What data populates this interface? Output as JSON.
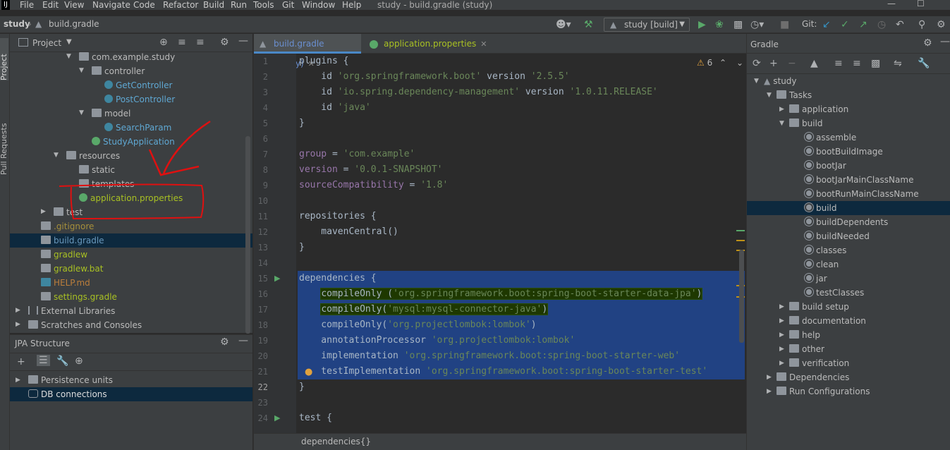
{
  "menubar": {
    "logo": "IJ",
    "items": [
      "File",
      "Edit",
      "View",
      "Navigate",
      "Code",
      "Refactor",
      "Build",
      "Run",
      "Tools",
      "Git",
      "Window",
      "Help"
    ],
    "window_title": "study - build.gradle (study)"
  },
  "navbar": {
    "project": "study",
    "file": "build.gradle",
    "run_config": "study [build]",
    "git_label": "Git:"
  },
  "left_stripe": {
    "project_tab": "Project",
    "pr_tab": "Pull Requests"
  },
  "project_panel": {
    "header": "Project",
    "tree": [
      {
        "label": "com.example.study",
        "kind": "package"
      },
      {
        "label": "controller",
        "kind": "package"
      },
      {
        "label": "GetController",
        "kind": "class"
      },
      {
        "label": "PostController",
        "kind": "class"
      },
      {
        "label": "model",
        "kind": "package"
      },
      {
        "label": "SearchParam",
        "kind": "class"
      },
      {
        "label": "StudyApplication",
        "kind": "class"
      },
      {
        "label": "resources",
        "kind": "folder"
      },
      {
        "label": "static",
        "kind": "folder"
      },
      {
        "label": "templates",
        "kind": "folder"
      },
      {
        "label": "application.properties",
        "kind": "file"
      },
      {
        "label": "test",
        "kind": "folder"
      },
      {
        "label": ".gitignore",
        "kind": "file"
      },
      {
        "label": "build.gradle",
        "kind": "file"
      },
      {
        "label": "gradlew",
        "kind": "file"
      },
      {
        "label": "gradlew.bat",
        "kind": "file"
      },
      {
        "label": "HELP.md",
        "kind": "file"
      },
      {
        "label": "settings.gradle",
        "kind": "file"
      },
      {
        "label": "External Libraries",
        "kind": "lib"
      },
      {
        "label": "Scratches and Consoles",
        "kind": "scratch"
      }
    ]
  },
  "jpa_panel": {
    "header": "JPA Structure",
    "items": [
      "Persistence units",
      "DB connections"
    ]
  },
  "editor": {
    "tabs": [
      {
        "label": "build.gradle (study)",
        "active": true
      },
      {
        "label": "application.properties",
        "active": false
      }
    ],
    "warnings": "6",
    "line_numbers": [
      "1",
      "2",
      "3",
      "4",
      "5",
      "6",
      "7",
      "8",
      "9",
      "10",
      "11",
      "12",
      "13",
      "14",
      "15",
      "16",
      "17",
      "18",
      "19",
      "20",
      "21",
      "22",
      "23",
      "24"
    ],
    "breadcrumb": "dependencies{}"
  },
  "gradle_panel": {
    "header": "Gradle",
    "tree": {
      "root": "study",
      "tasks": "Tasks",
      "application": "application",
      "build_group": "build",
      "build_tasks": [
        "assemble",
        "bootBuildImage",
        "bootJar",
        "bootJarMainClassName",
        "bootRunMainClassName",
        "build",
        "buildDependents",
        "buildNeeded",
        "classes",
        "clean",
        "jar",
        "testClasses"
      ],
      "other_groups": [
        "build setup",
        "documentation",
        "help",
        "other",
        "verification"
      ],
      "dependencies": "Dependencies",
      "run_configurations": "Run Configurations"
    }
  },
  "code": {
    "l1": "plugins {",
    "l2a": "    id ",
    "l2b": "'org.springframework.boot'",
    "l2c": " version ",
    "l2d": "'2.5.5'",
    "l3a": "    id ",
    "l3b": "'io.spring.dependency-management'",
    "l3c": " version ",
    "l3d": "'1.0.11.RELEASE'",
    "l4a": "    id ",
    "l4b": "'java'",
    "l5": "}",
    "l7a": "group",
    "l7b": " = ",
    "l7c": "'com.example'",
    "l8a": "version",
    "l8b": " = ",
    "l8c": "'0.0.1-SNAPSHOT'",
    "l9a": "sourceCompatibility",
    "l9b": " = ",
    "l9c": "'1.8'",
    "l11": "repositories {",
    "l12": "    mavenCentral()",
    "l13": "}",
    "l15": "dependencies {",
    "l16a": "compileOnly (",
    "l16b": "'org.springframework.boot:spring-boot-starter-data-jpa'",
    "l16c": ")",
    "l17a": "compileOnly(",
    "l17b": "'mysql:mysql-connector-java'",
    "l17c": ")",
    "l18a": "    compileOnly(",
    "l18b": "'org.projectlombok:lombok'",
    "l18c": ")",
    "l19a": "    annotationProcessor ",
    "l19b": "'org.projectlombok:lombok'",
    "l20a": "    implementation ",
    "l20b": "'org.springframework.boot:spring-boot-starter-web'",
    "l21a": "    testImplementation ",
    "l21b": "'org.springframework.boot:spring-boot-starter-test'",
    "l22": "}",
    "l24": "test {"
  },
  "colors": {
    "selection": "#214283",
    "string": "#6a8759",
    "annotation": "#e01010"
  }
}
